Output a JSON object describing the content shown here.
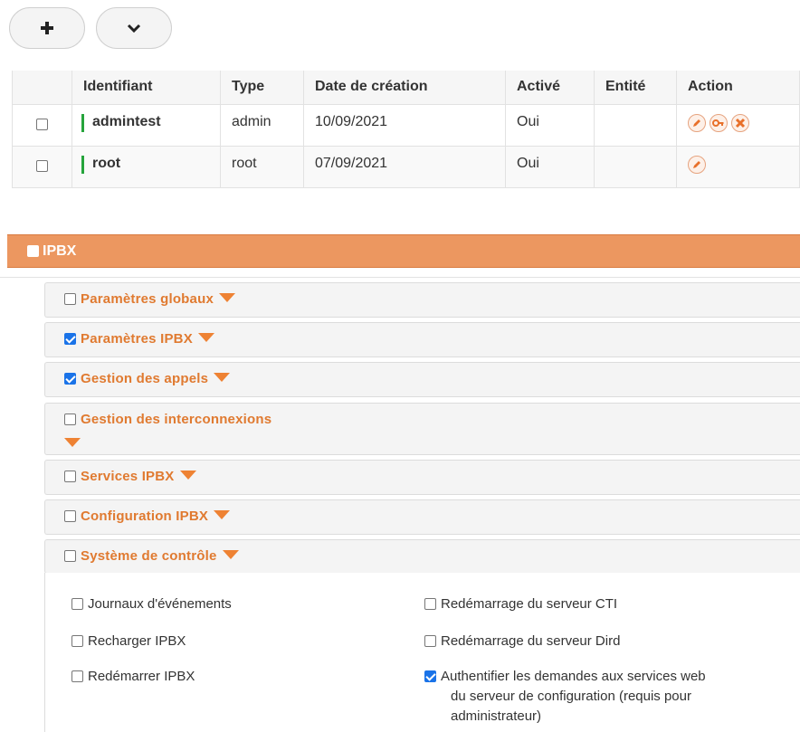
{
  "toolbar": {
    "add_label": "+",
    "add_icon": "plus-icon",
    "menu_icon": "chevron-down-icon"
  },
  "users_table": {
    "columns": [
      "Identifiant",
      "Type",
      "Date de création",
      "Activé",
      "Entité",
      "Action"
    ],
    "rows": [
      {
        "identifiant": "admintest",
        "type": "admin",
        "date": "10/09/2021",
        "active": "Oui",
        "entity": "",
        "actions": [
          "edit-icon",
          "key-icon",
          "delete-icon"
        ],
        "checked": false
      },
      {
        "identifiant": "root",
        "type": "root",
        "date": "07/09/2021",
        "active": "Oui",
        "entity": "",
        "actions": [
          "edit-icon"
        ],
        "checked": false
      }
    ]
  },
  "ipbx": {
    "title": "IPBX",
    "checked": false,
    "groups": [
      {
        "label": "Paramètres globaux",
        "checked": false
      },
      {
        "label": "Paramètres IPBX",
        "checked": true
      },
      {
        "label": "Gestion des appels",
        "checked": true
      },
      {
        "label": "Gestion des interconnexions",
        "checked": false
      },
      {
        "label": "Services IPBX",
        "checked": false
      },
      {
        "label": "Configuration IPBX",
        "checked": false
      },
      {
        "label": "Système de contrôle",
        "checked": false
      }
    ],
    "controle_permissions": [
      {
        "label": "Journaux d'événements",
        "checked": false
      },
      {
        "label": "Redémarrage du serveur CTI",
        "checked": false
      },
      {
        "label": "Recharger IPBX",
        "checked": false
      },
      {
        "label": "Redémarrage du serveur Dird",
        "checked": false
      },
      {
        "label": "Redémarrer IPBX",
        "checked": false
      },
      {
        "label": "Authentifier les demandes aux services web",
        "label_line2": "du serveur de configuration (requis pour",
        "label_line3": "administrateur)",
        "checked": true
      }
    ]
  },
  "colors": {
    "accent_orange": "#ec9760",
    "group_title_orange": "#e07a30",
    "active_green": "#26a43c",
    "checkbox_blue": "#1a73e8"
  }
}
